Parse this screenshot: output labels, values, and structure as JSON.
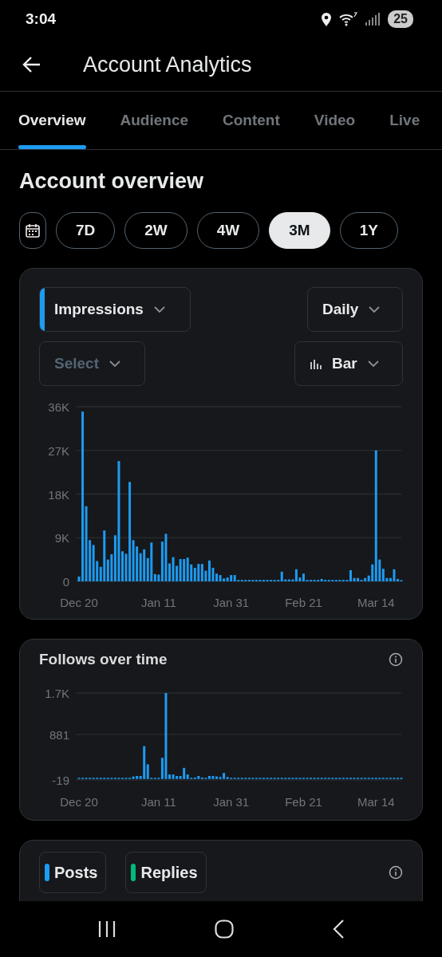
{
  "status_bar": {
    "time": "3:04",
    "battery": "25"
  },
  "header": {
    "title": "Account Analytics"
  },
  "tabs": [
    {
      "label": "Overview",
      "selected": true
    },
    {
      "label": "Audience",
      "selected": false
    },
    {
      "label": "Content",
      "selected": false
    },
    {
      "label": "Video",
      "selected": false
    },
    {
      "label": "Live",
      "selected": false
    }
  ],
  "section_title": "Account overview",
  "range_buttons": [
    {
      "label": "7D",
      "selected": false
    },
    {
      "label": "2W",
      "selected": false
    },
    {
      "label": "4W",
      "selected": false
    },
    {
      "label": "3M",
      "selected": true
    },
    {
      "label": "1Y",
      "selected": false
    }
  ],
  "impressions_card": {
    "metric_dropdown": "Impressions",
    "interval_dropdown": "Daily",
    "compare_dropdown": {
      "label": "Select",
      "disabled": true
    },
    "chart_type_dropdown": "Bar",
    "chart_data": {
      "type": "bar",
      "categories": [
        "Dec 20",
        null,
        null,
        null,
        null,
        null,
        null,
        null,
        null,
        null,
        null,
        null,
        null,
        null,
        null,
        null,
        null,
        null,
        null,
        null,
        null,
        null,
        "Jan 11",
        null,
        null,
        null,
        null,
        null,
        null,
        null,
        null,
        null,
        null,
        null,
        null,
        null,
        null,
        null,
        null,
        null,
        null,
        null,
        "Jan 31",
        null,
        null,
        null,
        null,
        null,
        null,
        null,
        null,
        null,
        null,
        null,
        null,
        null,
        null,
        null,
        null,
        null,
        null,
        null,
        "Feb 21",
        null,
        null,
        null,
        null,
        null,
        null,
        null,
        null,
        null,
        null,
        null,
        null,
        null,
        null,
        null,
        null,
        null,
        null,
        null,
        "Mar 14",
        null,
        null,
        null,
        null,
        null,
        null,
        null
      ],
      "series": [
        {
          "color": "#1d9bf0",
          "values": [
            1000,
            35000,
            15500,
            8500,
            7500,
            4200,
            3000,
            10500,
            4500,
            5600,
            9500,
            24800,
            6200,
            5700,
            20500,
            8500,
            7200,
            5800,
            6600,
            4800,
            8000,
            1500,
            1400,
            8200,
            9800,
            3700,
            5000,
            3200,
            4600,
            4600,
            4900,
            3500,
            2800,
            3600,
            3600,
            2200,
            4300,
            2800,
            1600,
            1300,
            600,
            800,
            1300,
            1300,
            300,
            300,
            300,
            300,
            300,
            300,
            300,
            300,
            300,
            300,
            300,
            300,
            2000,
            400,
            400,
            400,
            2500,
            800,
            1600,
            300,
            300,
            300,
            300,
            500,
            300,
            300,
            300,
            300,
            300,
            300,
            300,
            2300,
            700,
            700,
            300,
            700,
            1200,
            3500,
            27000,
            4500,
            2600,
            700,
            700,
            2500,
            500,
            200
          ]
        }
      ],
      "grid": true,
      "ylim": [
        0,
        36000
      ],
      "yticks": [
        {
          "value": 0,
          "label": "0"
        },
        {
          "value": 9000,
          "label": "9K"
        },
        {
          "value": 18000,
          "label": "18K"
        },
        {
          "value": 27000,
          "label": "27K"
        },
        {
          "value": 36000,
          "label": "36K"
        }
      ]
    }
  },
  "follows_card": {
    "title": "Follows over time",
    "chart_data": {
      "type": "bar",
      "categories": [
        "Dec 20",
        null,
        null,
        null,
        null,
        null,
        null,
        null,
        null,
        null,
        null,
        null,
        null,
        null,
        null,
        null,
        null,
        null,
        null,
        null,
        null,
        null,
        "Jan 11",
        null,
        null,
        null,
        null,
        null,
        null,
        null,
        null,
        null,
        null,
        null,
        null,
        null,
        null,
        null,
        null,
        null,
        null,
        null,
        "Jan 31",
        null,
        null,
        null,
        null,
        null,
        null,
        null,
        null,
        null,
        null,
        null,
        null,
        null,
        null,
        null,
        null,
        null,
        null,
        null,
        "Feb 21",
        null,
        null,
        null,
        null,
        null,
        null,
        null,
        null,
        null,
        null,
        null,
        null,
        null,
        null,
        null,
        null,
        null,
        null,
        null,
        "Mar 14",
        null,
        null,
        null,
        null,
        null,
        null,
        null
      ],
      "series": [
        {
          "color": "#1d9bf0",
          "values": [
            0,
            0,
            0,
            0,
            0,
            0,
            0,
            0,
            0,
            0,
            0,
            0,
            0,
            0,
            0,
            50,
            60,
            60,
            650,
            290,
            10,
            0,
            0,
            420,
            1700,
            90,
            90,
            60,
            60,
            220,
            90,
            20,
            30,
            60,
            30,
            20,
            60,
            60,
            50,
            40,
            120,
            40,
            10,
            0,
            0,
            0,
            0,
            0,
            0,
            0,
            0,
            0,
            0,
            0,
            0,
            0,
            0,
            0,
            0,
            0,
            0,
            0,
            0,
            0,
            0,
            0,
            0,
            0,
            0,
            0,
            0,
            0,
            0,
            0,
            0,
            0,
            0,
            0,
            0,
            0,
            0,
            0,
            0,
            0,
            0,
            0,
            0,
            0,
            0,
            0
          ]
        }
      ],
      "grid": true,
      "ylim": [
        -19,
        1700
      ],
      "yticks": [
        {
          "value": -19,
          "label": "-19"
        },
        {
          "value": 881,
          "label": "881"
        },
        {
          "value": 1700,
          "label": "1.7K"
        }
      ]
    }
  },
  "legend_card": {
    "chips": [
      {
        "label": "Posts",
        "color": "#1d9bf0"
      },
      {
        "label": "Replies",
        "color": "#00ba7c"
      }
    ]
  }
}
